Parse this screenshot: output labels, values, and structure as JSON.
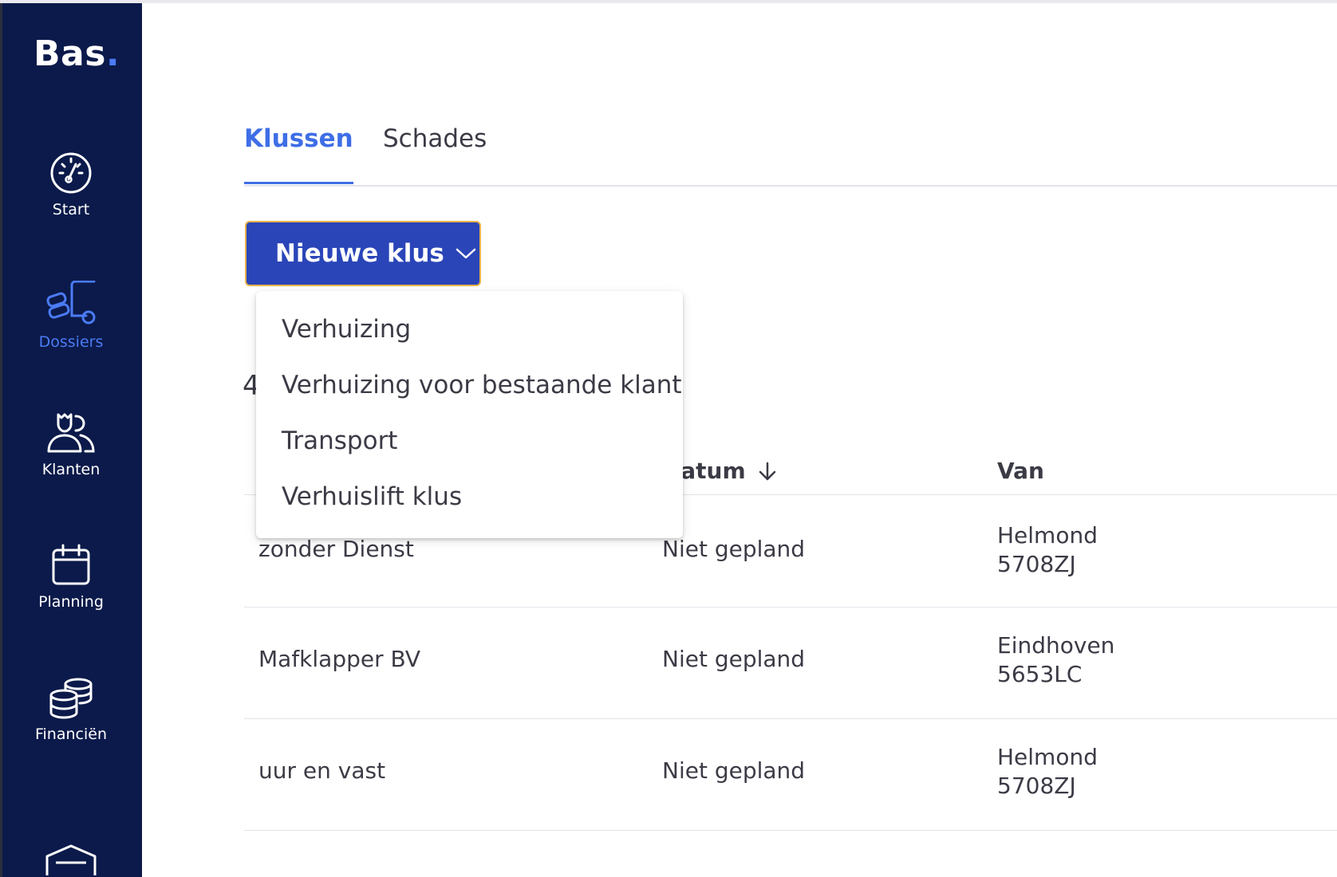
{
  "brand": {
    "name": "Bas",
    "dot": ".",
    "accent": "#4b7bf5",
    "sidebar_bg": "#0b1a4a"
  },
  "sidebar": {
    "items": [
      {
        "label": "Start",
        "icon": "speedometer-icon",
        "active": false
      },
      {
        "label": "Dossiers",
        "icon": "moving-truck-icon",
        "active": true
      },
      {
        "label": "Klanten",
        "icon": "users-icon",
        "active": false
      },
      {
        "label": "Planning",
        "icon": "calendar-icon",
        "active": false
      },
      {
        "label": "Financiën",
        "icon": "coins-icon",
        "active": false
      }
    ]
  },
  "tabs": [
    {
      "label": "Klussen",
      "active": true
    },
    {
      "label": "Schades",
      "active": false
    }
  ],
  "new_button": {
    "label": "Nieuwe klus",
    "icon": "chevron-down-icon"
  },
  "count_partial": "4",
  "dropdown": {
    "items": [
      "Verhuizing",
      "Verhuizing voor bestaande klant",
      "Transport",
      "Verhuislift klus"
    ]
  },
  "table": {
    "headers": {
      "datum": "Datum",
      "van": "Van"
    },
    "rows": [
      {
        "name": "zonder Dienst",
        "datum": "Niet gepland",
        "city": "Helmond",
        "postcode": "5708ZJ"
      },
      {
        "name": "Mafklapper BV",
        "datum": "Niet gepland",
        "city": "Eindhoven",
        "postcode": "5653LC"
      },
      {
        "name": "uur en vast",
        "datum": "Niet gepland",
        "city": "Helmond",
        "postcode": "5708ZJ"
      }
    ]
  }
}
